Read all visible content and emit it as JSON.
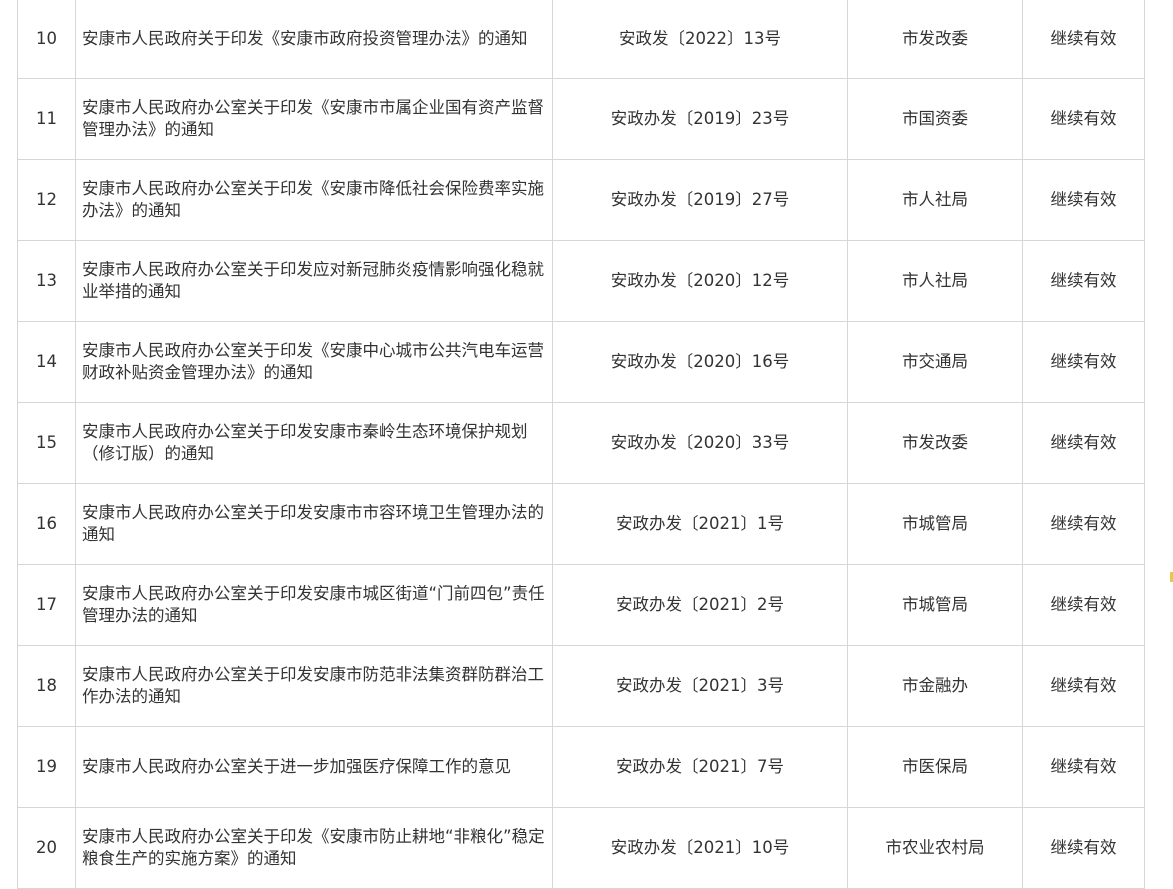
{
  "table": {
    "rows": [
      {
        "num": "10",
        "title": "安康市人民政府关于印发《安康市政府投资管理办法》的通知",
        "docno": "安政发〔2022〕13号",
        "dept": "市发改委",
        "status": "继续有效"
      },
      {
        "num": "11",
        "title": "安康市人民政府办公室关于印发《安康市市属企业国有资产监督管理办法》的通知",
        "docno": "安政办发〔2019〕23号",
        "dept": "市国资委",
        "status": "继续有效"
      },
      {
        "num": "12",
        "title": "安康市人民政府办公室关于印发《安康市降低社会保险费率实施办法》的通知",
        "docno": "安政办发〔2019〕27号",
        "dept": "市人社局",
        "status": "继续有效"
      },
      {
        "num": "13",
        "title": "安康市人民政府办公室关于印发应对新冠肺炎疫情影响强化稳就业举措的通知",
        "docno": "安政办发〔2020〕12号",
        "dept": "市人社局",
        "status": "继续有效"
      },
      {
        "num": "14",
        "title": "安康市人民政府办公室关于印发《安康中心城市公共汽电车运营财政补贴资金管理办法》的通知",
        "docno": "安政办发〔2020〕16号",
        "dept": "市交通局",
        "status": "继续有效"
      },
      {
        "num": "15",
        "title": "安康市人民政府办公室关于印发安康市秦岭生态环境保护规划（修订版）的通知",
        "docno": "安政办发〔2020〕33号",
        "dept": "市发改委",
        "status": "继续有效"
      },
      {
        "num": "16",
        "title": "安康市人民政府办公室关于印发安康市市容环境卫生管理办法的通知",
        "docno": "安政办发〔2021〕1号",
        "dept": "市城管局",
        "status": "继续有效"
      },
      {
        "num": "17",
        "title": "安康市人民政府办公室关于印发安康市城区街道“门前四包”责任管理办法的通知",
        "docno": "安政办发〔2021〕2号",
        "dept": "市城管局",
        "status": "继续有效"
      },
      {
        "num": "18",
        "title": "安康市人民政府办公室关于印发安康市防范非法集资群防群治工作办法的通知",
        "docno": "安政办发〔2021〕3号",
        "dept": "市金融办",
        "status": "继续有效"
      },
      {
        "num": "19",
        "title": "安康市人民政府办公室关于进一步加强医疗保障工作的意见",
        "docno": "安政办发〔2021〕7号",
        "dept": "市医保局",
        "status": "继续有效"
      },
      {
        "num": "20",
        "title": "安康市人民政府办公室关于印发《安康市防止耕地“非粮化”稳定粮食生产的实施方案》的通知",
        "docno": "安政办发〔2021〕10号",
        "dept": "市农业农村局",
        "status": "继续有效"
      }
    ]
  }
}
